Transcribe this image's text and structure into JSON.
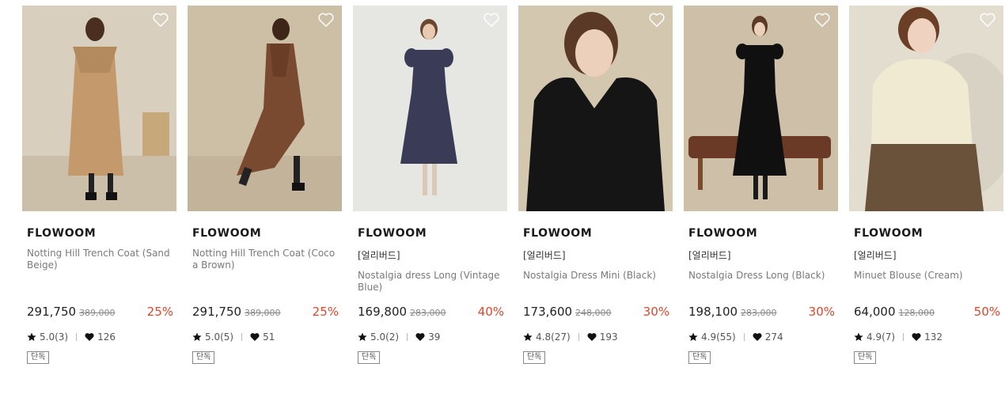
{
  "products": [
    {
      "brand": "FLOWOOM",
      "tag": "",
      "name": "Notting Hill Trench Coat (Sand Beige)",
      "price": "291,750",
      "original_price": "389,000",
      "discount": "25%",
      "rating": "5.0(3)",
      "likes": "126",
      "badge": "단독"
    },
    {
      "brand": "FLOWOOM",
      "tag": "",
      "name": "Notting Hill Trench Coat (Cocoa Brown)",
      "price": "291,750",
      "original_price": "389,000",
      "discount": "25%",
      "rating": "5.0(5)",
      "likes": "51",
      "badge": "단독"
    },
    {
      "brand": "FLOWOOM",
      "tag": "[얼리버드]",
      "name": "Nostalgia dress Long (Vintage Blue)",
      "price": "169,800",
      "original_price": "283,000",
      "discount": "40%",
      "rating": "5.0(2)",
      "likes": "39",
      "badge": "단독"
    },
    {
      "brand": "FLOWOOM",
      "tag": "[얼리버드]",
      "name": "Nostalgia Dress Mini (Black)",
      "price": "173,600",
      "original_price": "248,000",
      "discount": "30%",
      "rating": "4.8(27)",
      "likes": "193",
      "badge": "단독"
    },
    {
      "brand": "FLOWOOM",
      "tag": "[얼리버드]",
      "name": "Nostalgia Dress Long (Black)",
      "price": "198,100",
      "original_price": "283,000",
      "discount": "30%",
      "rating": "4.9(55)",
      "likes": "274",
      "badge": "단독"
    },
    {
      "brand": "FLOWOOM",
      "tag": "[얼리버드]",
      "name": "Minuet Blouse (Cream)",
      "price": "64,000",
      "original_price": "128,000",
      "discount": "50%",
      "rating": "4.9(7)",
      "likes": "132",
      "badge": "단독"
    }
  ],
  "colors": {
    "discount": "#e0462b",
    "muted_text": "#7a7a7a"
  },
  "icons": {
    "wishlist": "heart-outline-icon",
    "rating": "star-icon",
    "likes": "heart-filled-icon"
  }
}
